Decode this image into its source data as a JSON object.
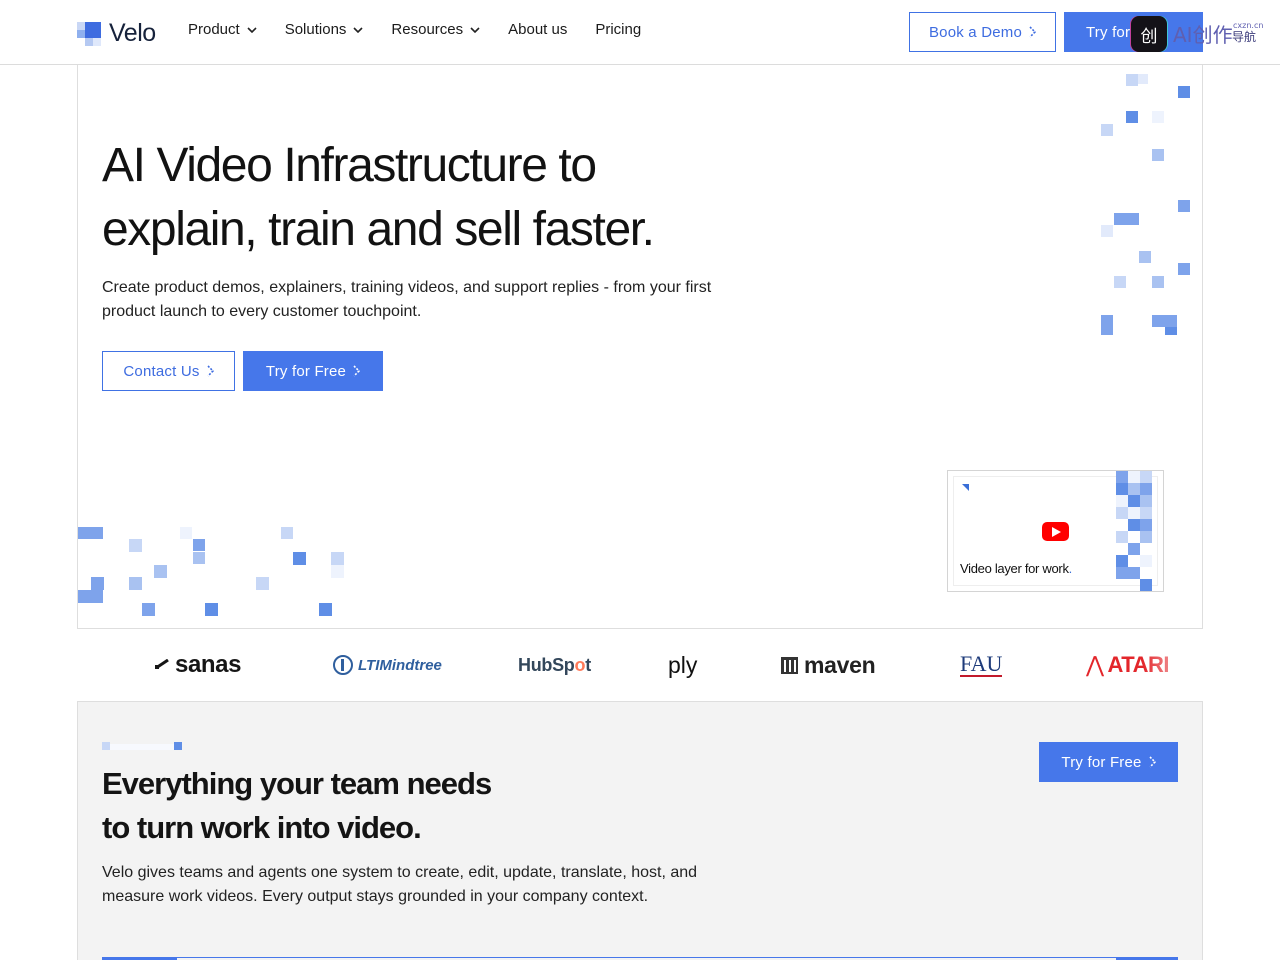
{
  "colors": {
    "accent": "#4677ea",
    "accent_text": "#3e6ce0",
    "brand_dark": "#16223b",
    "section_bg": "#f3f3f3"
  },
  "header": {
    "brand": "Velo",
    "nav": [
      {
        "label": "Product",
        "has_dropdown": true
      },
      {
        "label": "Solutions",
        "has_dropdown": true
      },
      {
        "label": "Resources",
        "has_dropdown": true
      },
      {
        "label": "About us",
        "has_dropdown": false
      },
      {
        "label": "Pricing",
        "has_dropdown": false
      }
    ],
    "book_demo": "Book a Demo",
    "try_free": "Try for Free",
    "watermark": {
      "icon_glyph": "创",
      "text": "AI创作",
      "sub": "cxzn.cn",
      "sub2": "导航"
    }
  },
  "hero": {
    "title_line1": "AI Video Infrastructure to",
    "title_line2": "explain, train and sell faster.",
    "subtitle": "Create product demos, explainers, training videos, and support replies - from your first product launch to every customer touchpoint.",
    "contact_button": "Contact Us",
    "try_button": "Try for Free",
    "video_card": {
      "label": "Video layer for work",
      "play_icon": "youtube-play-icon"
    }
  },
  "logos": [
    "sanas",
    "LTIMindtree",
    "HubSpot",
    "ply",
    "maven",
    "FAU",
    "ATARI"
  ],
  "features": {
    "title_line1": "Everything your team needs",
    "title_line2": "to turn work into video.",
    "subtitle": "Velo gives teams and agents one system to create, edit, update, translate, host, and measure work videos. Every output stays grounded in your company context.",
    "try_button": "Try for Free"
  }
}
